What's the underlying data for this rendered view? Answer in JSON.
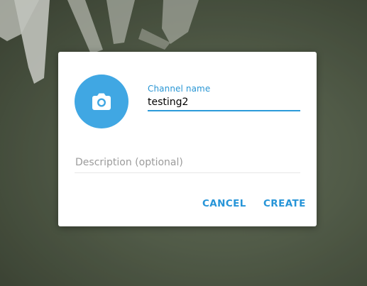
{
  "dialog": {
    "photo_icon": "camera-icon",
    "channel_name_label": "Channel name",
    "channel_name_value": "testing2",
    "description_placeholder": "Description (optional)",
    "cancel_label": "CANCEL",
    "create_label": "CREATE"
  },
  "colors": {
    "accent": "#40a7e3",
    "link": "#2795d8"
  }
}
